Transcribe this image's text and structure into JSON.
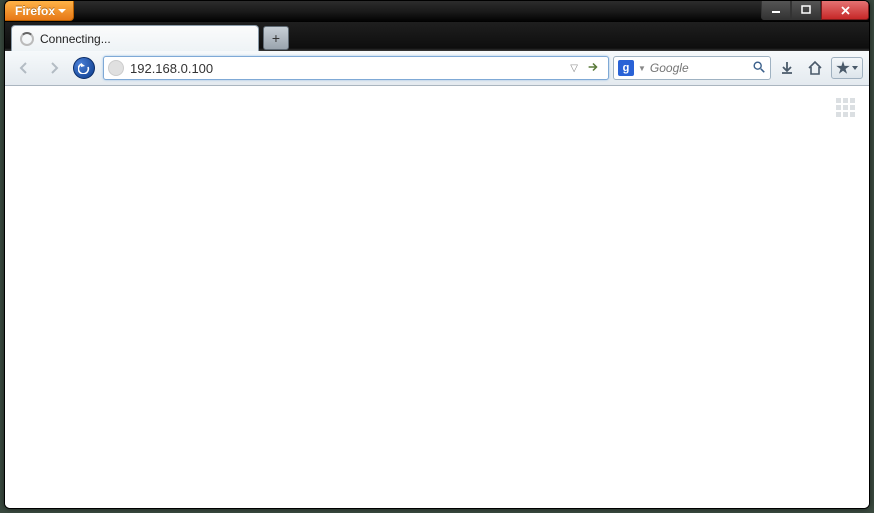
{
  "app": {
    "menu_label": "Firefox"
  },
  "tab": {
    "title": "Connecting..."
  },
  "newtab": {
    "symbol": "+"
  },
  "url": {
    "value": "192.168.0.100"
  },
  "search": {
    "engine_letter": "g",
    "placeholder": "Google"
  }
}
